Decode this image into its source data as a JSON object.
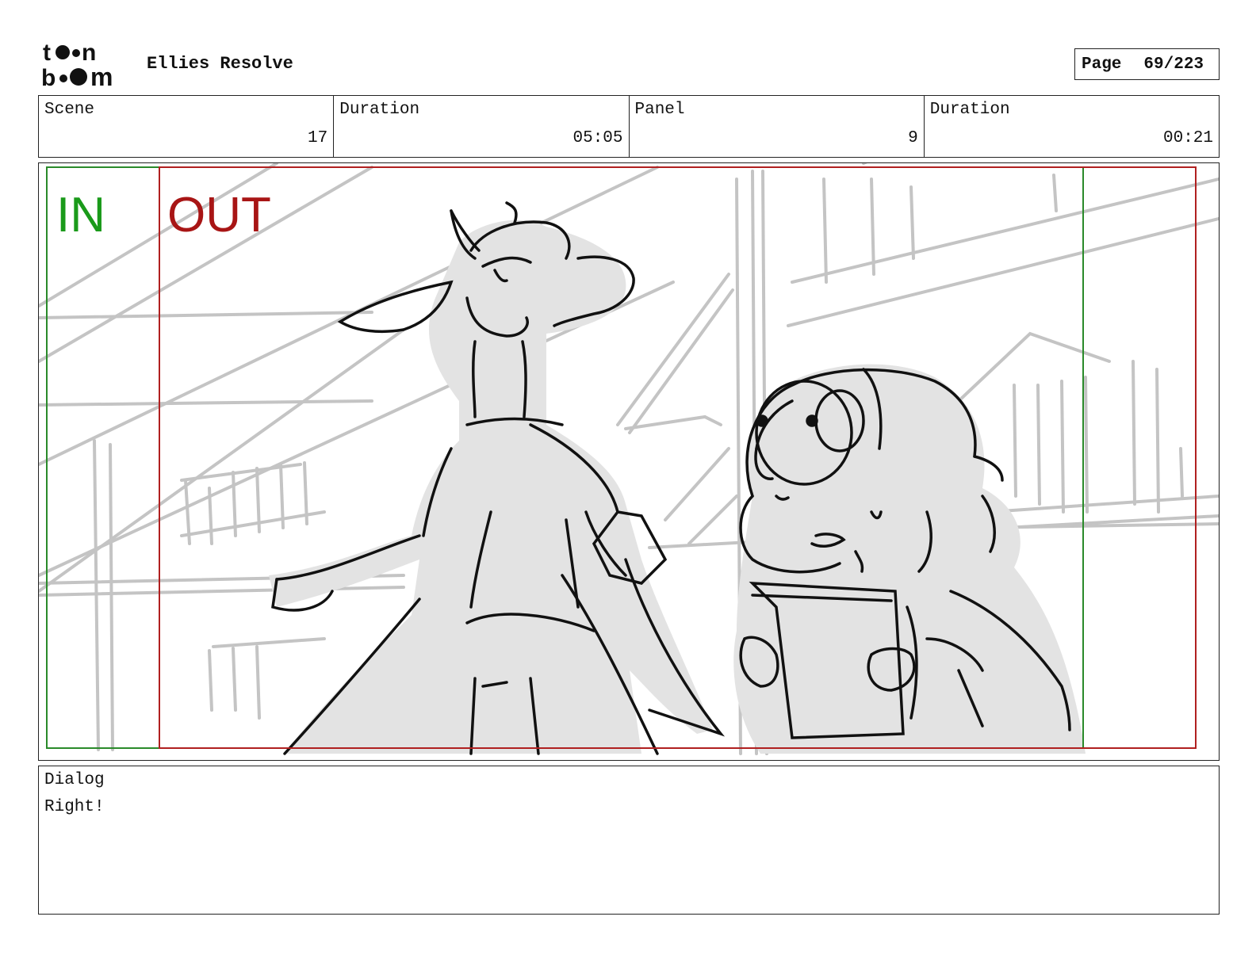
{
  "header": {
    "logo_text": "toon boom",
    "project_title": "Ellies Resolve",
    "page_label": "Page",
    "page_value": "69/223"
  },
  "info": {
    "scene_label": "Scene",
    "scene_value": "17",
    "scene_duration_label": "Duration",
    "scene_duration_value": "05:05",
    "panel_label": "Panel",
    "panel_value": "9",
    "panel_duration_label": "Duration",
    "panel_duration_value": "00:21"
  },
  "panel": {
    "in_marker": "IN",
    "out_marker": "OUT",
    "in_color": "#1a9a1a",
    "out_color": "#a81515"
  },
  "dialog": {
    "label": "Dialog",
    "text": "Right!"
  }
}
